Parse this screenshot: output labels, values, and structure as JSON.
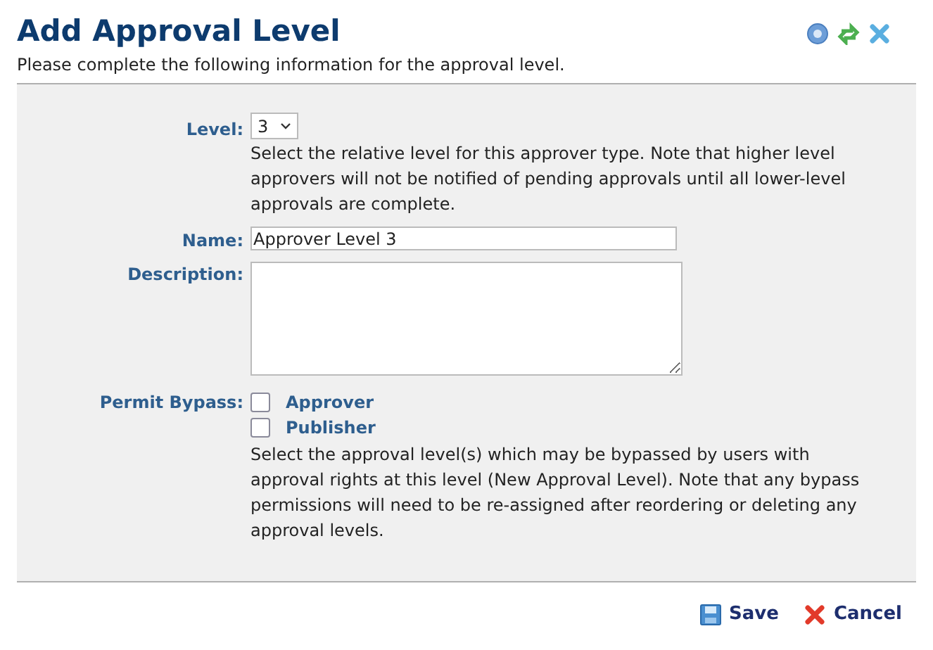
{
  "header": {
    "title": "Add Approval Level",
    "subtitle": "Please complete the following information for the approval level."
  },
  "form": {
    "level": {
      "label": "Level:",
      "value": "3",
      "help": "Select the relative level for this approver type. Note that higher level approvers will not be notified of pending approvals until all lower-level approvals are complete."
    },
    "name": {
      "label": "Name:",
      "value": "Approver Level 3"
    },
    "description": {
      "label": "Description:"
    },
    "bypass": {
      "label": "Permit Bypass:",
      "options": [
        {
          "label": "Approver",
          "checked": false
        },
        {
          "label": "Publisher",
          "checked": false
        }
      ],
      "help": "Select the approval level(s) which may be bypassed by users with approval rights at this level (New Approval Level). Note that any bypass permissions will need to be re-assigned after reordering or deleting any approval levels."
    }
  },
  "buttons": [
    {
      "kind": "save",
      "label": "Save"
    },
    {
      "kind": "cancel",
      "label": "Cancel"
    }
  ]
}
